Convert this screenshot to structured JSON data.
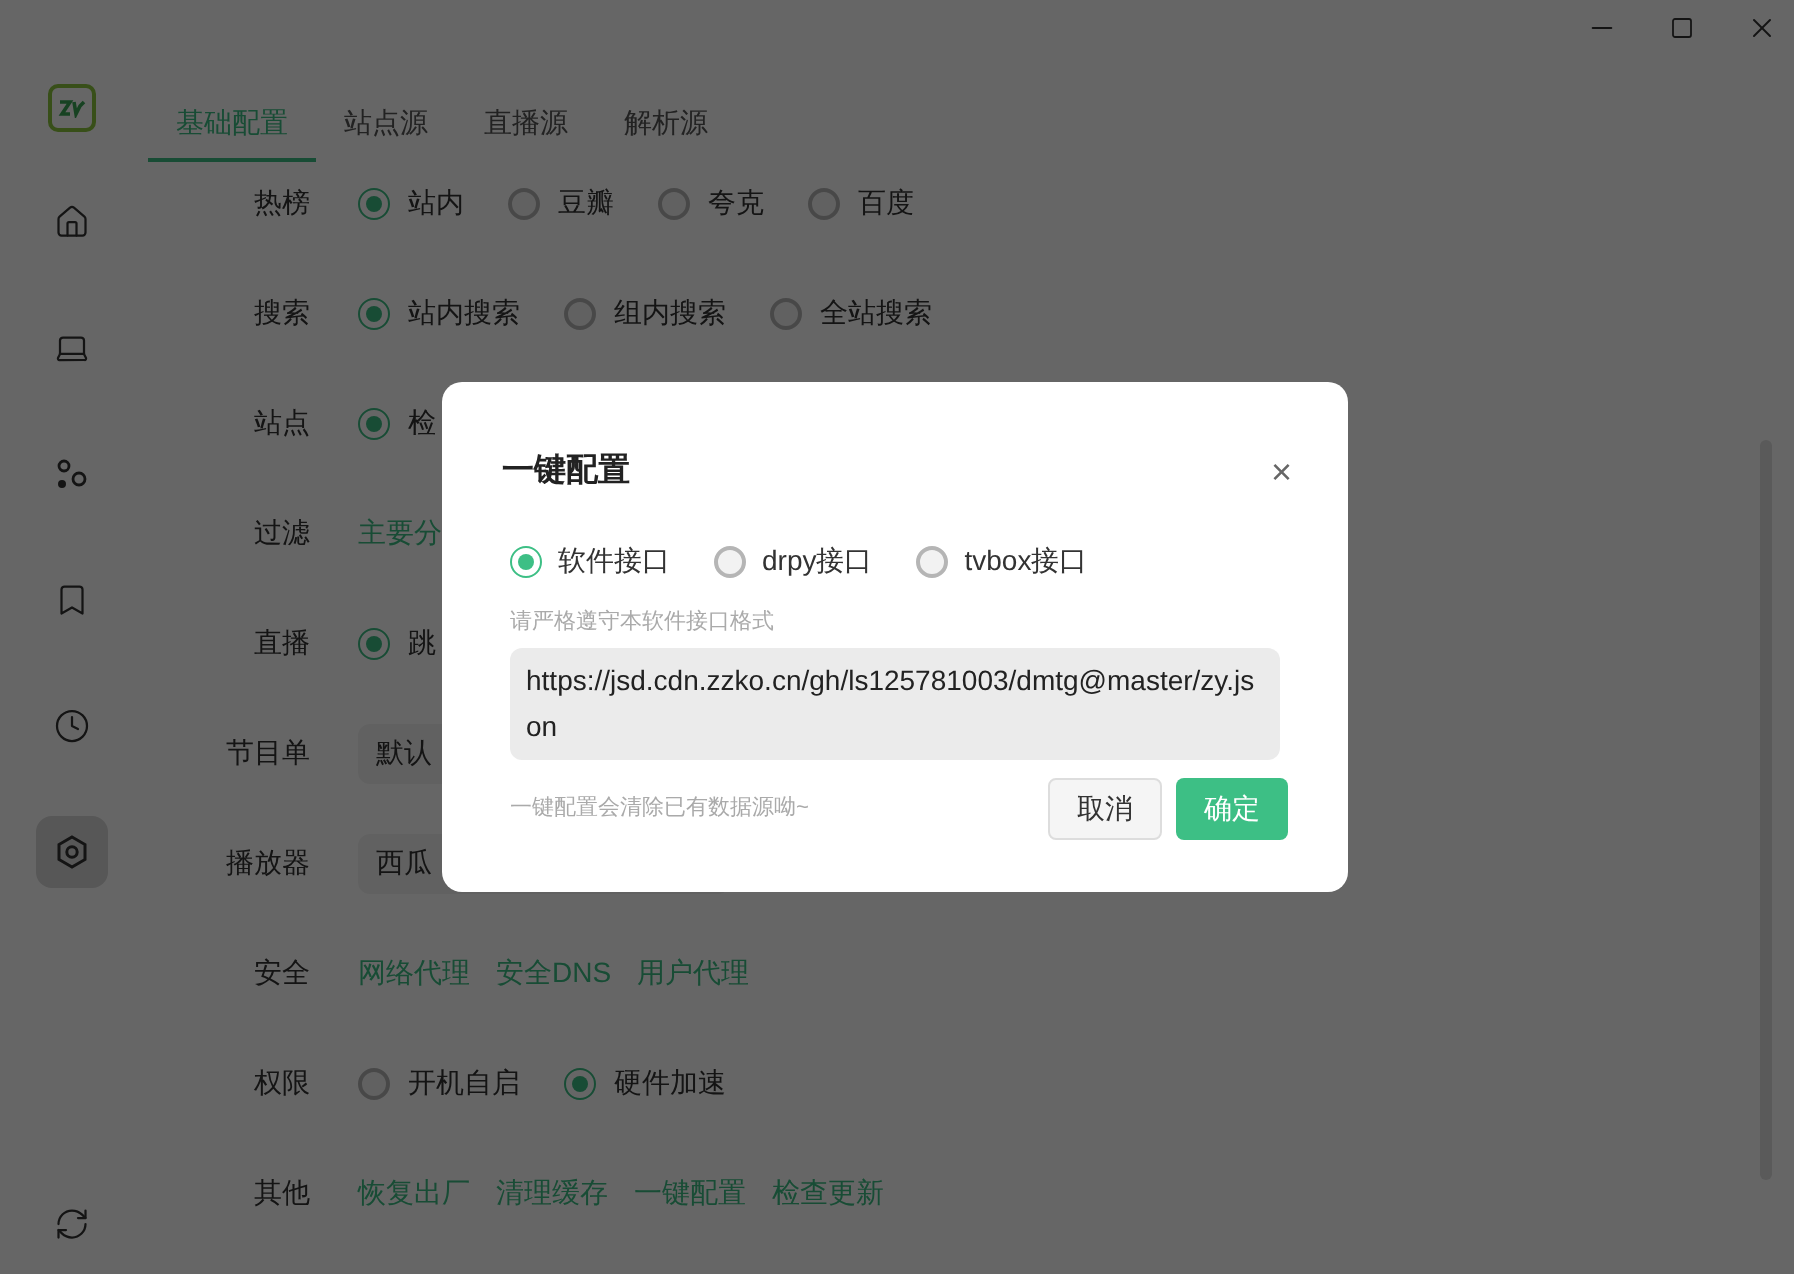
{
  "sidebar": {
    "items": [
      {
        "kind": "home",
        "selected": false
      },
      {
        "kind": "laptop",
        "selected": false
      },
      {
        "kind": "dots",
        "selected": false
      },
      {
        "kind": "bookmark",
        "selected": false
      },
      {
        "kind": "clock",
        "selected": false
      },
      {
        "kind": "settings",
        "selected": true
      }
    ]
  },
  "tabs": [
    {
      "label": "基础配置",
      "selected": true
    },
    {
      "label": "站点源",
      "selected": false
    },
    {
      "label": "直播源",
      "selected": false
    },
    {
      "label": "解析源",
      "selected": false
    }
  ],
  "settings": [
    {
      "label": "热榜",
      "kind": "radio",
      "options": [
        {
          "label": "站内",
          "selected": true
        },
        {
          "label": "豆瓣",
          "selected": false
        },
        {
          "label": "夸克",
          "selected": false
        },
        {
          "label": "百度",
          "selected": false
        }
      ]
    },
    {
      "label": "搜索",
      "kind": "radio",
      "options": [
        {
          "label": "站内搜索",
          "selected": true
        },
        {
          "label": "组内搜索",
          "selected": false
        },
        {
          "label": "全站搜索",
          "selected": false
        }
      ]
    },
    {
      "label": "站点",
      "kind": "radio",
      "options": [
        {
          "label": "检",
          "selected": true
        }
      ]
    },
    {
      "label": "过滤",
      "kind": "links",
      "links": [
        "主要分"
      ]
    },
    {
      "label": "直播",
      "kind": "radio",
      "options": [
        {
          "label": "跳",
          "selected": true
        }
      ]
    },
    {
      "label": "节目单",
      "kind": "select",
      "value": "默认"
    },
    {
      "label": "播放器",
      "kind": "select",
      "value": "西瓜"
    },
    {
      "label": "安全",
      "kind": "links",
      "links": [
        "网络代理",
        "安全DNS",
        "用户代理"
      ]
    },
    {
      "label": "权限",
      "kind": "radio",
      "options": [
        {
          "label": "开机自启",
          "selected": false
        },
        {
          "label": "硬件加速",
          "selected": true
        }
      ]
    },
    {
      "label": "其他",
      "kind": "links",
      "links": [
        "恢复出厂",
        "清理缓存",
        "一键配置",
        "检查更新"
      ]
    }
  ],
  "dialog": {
    "title": "一键配置",
    "close": "×",
    "options": [
      {
        "label": "软件接口",
        "selected": true
      },
      {
        "label": "drpy接口",
        "selected": false
      },
      {
        "label": "tvbox接口",
        "selected": false
      }
    ],
    "hint": "请严格遵守本软件接口格式",
    "value": "https://jsd.cdn.zzko.cn/gh/ls125781003/dmtg@master/zy.json",
    "note": "一键配置会清除已有数据源呦~",
    "cancel": "取消",
    "confirm": "确定"
  }
}
